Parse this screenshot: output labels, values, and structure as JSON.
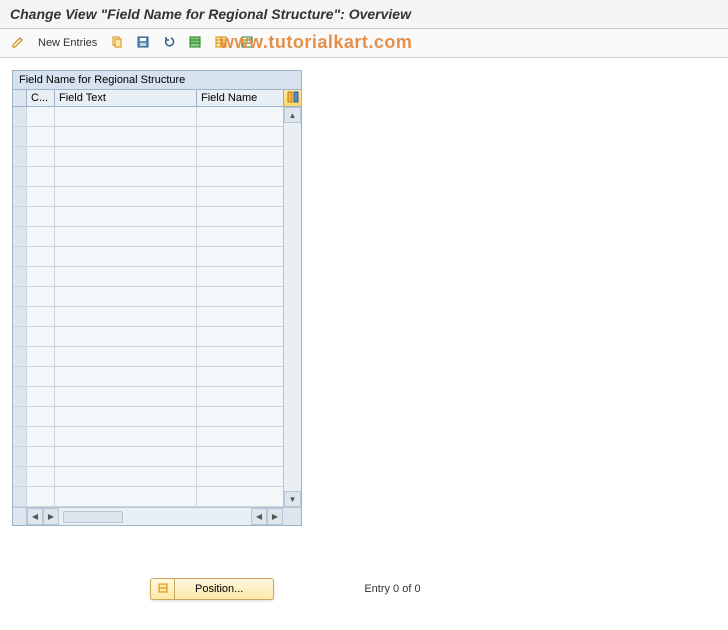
{
  "title": "Change View \"Field Name for Regional Structure\": Overview",
  "toolbar": {
    "new_entries": "New Entries"
  },
  "watermark": "www.tutorialkart.com",
  "table": {
    "panel_title": "Field Name for Regional Structure",
    "columns": {
      "c": "C...",
      "field_text": "Field Text",
      "field_name": "Field Name"
    },
    "rows": [
      {},
      {},
      {},
      {},
      {},
      {},
      {},
      {},
      {},
      {},
      {},
      {},
      {},
      {},
      {},
      {},
      {},
      {},
      {},
      {}
    ]
  },
  "footer": {
    "position_label": "Position...",
    "entry_text": "Entry 0 of 0"
  },
  "icons": {
    "pencil": "pencil-icon",
    "copy": "copy-icon",
    "save": "save-icon",
    "undo": "undo-icon",
    "select_all": "select-all-icon",
    "table": "table-icon",
    "deselect": "deselect-icon",
    "col_config": "column-config-icon",
    "position": "position-icon"
  }
}
